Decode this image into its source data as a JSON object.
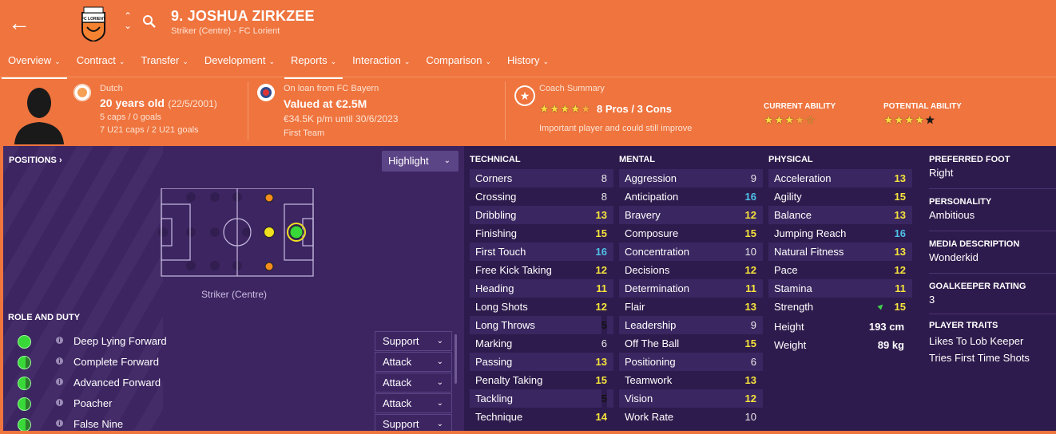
{
  "header": {
    "name": "9. JOSHUA ZIRKZEE",
    "subtitle": "Striker (Centre) - FC Lorient",
    "crest_text": "FC LORIENT"
  },
  "tabs": [
    {
      "label": "Overview",
      "active": true
    },
    {
      "label": "Contract"
    },
    {
      "label": "Transfer"
    },
    {
      "label": "Development"
    },
    {
      "label": "Reports",
      "active": true
    },
    {
      "label": "Interaction"
    },
    {
      "label": "Comparison"
    },
    {
      "label": "History"
    }
  ],
  "info": {
    "nationality": "Dutch",
    "age": "20 years old",
    "dob": "(22/5/2001)",
    "caps": "5 caps / 0 goals",
    "u21_caps": "7 U21 caps / 2 U21 goals",
    "loan_label": "On loan from FC Bayern",
    "value": "Valued at €2.5M",
    "wage": "€34.5K p/m until 30/6/2023",
    "squad": "First Team",
    "coach_label": "Coach Summary",
    "coach_rating": 4.5,
    "pros_cons": "8 Pros / 3 Cons",
    "coach_note": "Important player and could still improve",
    "ca_label": "CURRENT ABILITY",
    "ca_stars": 3.5,
    "pa_label": "POTENTIAL ABILITY",
    "pa_stars": 5
  },
  "positions": {
    "title": "POSITIONS",
    "highlight_label": "Highlight",
    "caption": "Striker (Centre)"
  },
  "roles": {
    "title": "ROLE AND DUTY",
    "items": [
      {
        "name": "Deep Lying Forward",
        "duty": "Support"
      },
      {
        "name": "Complete Forward",
        "duty": "Attack"
      },
      {
        "name": "Advanced Forward",
        "duty": "Attack"
      },
      {
        "name": "Poacher",
        "duty": "Attack"
      },
      {
        "name": "False Nine",
        "duty": "Support"
      }
    ]
  },
  "technical": {
    "title": "TECHNICAL",
    "rows": [
      {
        "name": "Corners",
        "value": "8"
      },
      {
        "name": "Crossing",
        "value": "8"
      },
      {
        "name": "Dribbling",
        "value": "13"
      },
      {
        "name": "Finishing",
        "value": "15"
      },
      {
        "name": "First Touch",
        "value": "16"
      },
      {
        "name": "Free Kick Taking",
        "value": "12"
      },
      {
        "name": "Heading",
        "value": "11"
      },
      {
        "name": "Long Shots",
        "value": "12"
      },
      {
        "name": "Long Throws",
        "value": "5"
      },
      {
        "name": "Marking",
        "value": "6"
      },
      {
        "name": "Passing",
        "value": "13"
      },
      {
        "name": "Penalty Taking",
        "value": "15"
      },
      {
        "name": "Tackling",
        "value": "5"
      },
      {
        "name": "Technique",
        "value": "14"
      }
    ]
  },
  "mental": {
    "title": "MENTAL",
    "rows": [
      {
        "name": "Aggression",
        "value": "9"
      },
      {
        "name": "Anticipation",
        "value": "16"
      },
      {
        "name": "Bravery",
        "value": "12"
      },
      {
        "name": "Composure",
        "value": "15"
      },
      {
        "name": "Concentration",
        "value": "10"
      },
      {
        "name": "Decisions",
        "value": "12"
      },
      {
        "name": "Determination",
        "value": "11"
      },
      {
        "name": "Flair",
        "value": "13"
      },
      {
        "name": "Leadership",
        "value": "9"
      },
      {
        "name": "Off The Ball",
        "value": "15"
      },
      {
        "name": "Positioning",
        "value": "6"
      },
      {
        "name": "Teamwork",
        "value": "13"
      },
      {
        "name": "Vision",
        "value": "12"
      },
      {
        "name": "Work Rate",
        "value": "10"
      }
    ]
  },
  "physical": {
    "title": "PHYSICAL",
    "rows": [
      {
        "name": "Acceleration",
        "value": "13"
      },
      {
        "name": "Agility",
        "value": "15"
      },
      {
        "name": "Balance",
        "value": "13"
      },
      {
        "name": "Jumping Reach",
        "value": "16"
      },
      {
        "name": "Natural Fitness",
        "value": "13"
      },
      {
        "name": "Pace",
        "value": "12"
      },
      {
        "name": "Stamina",
        "value": "11"
      },
      {
        "name": "Strength",
        "value": "15"
      }
    ],
    "height_label": "Height",
    "height": "193 cm",
    "weight_label": "Weight",
    "weight": "89 kg"
  },
  "details": {
    "foot_title": "PREFERRED FOOT",
    "foot": "Right",
    "personality_title": "PERSONALITY",
    "personality": "Ambitious",
    "media_title": "MEDIA DESCRIPTION",
    "media": "Wonderkid",
    "gk_title": "GOALKEEPER RATING",
    "gk": "3",
    "traits_title": "PLAYER TRAITS",
    "traits": [
      "Likes To Lob Keeper",
      "Tries First Time Shots"
    ]
  },
  "colors": {
    "header_bg": "#ef743e",
    "panel_left": "#3d2562",
    "panel_right": "#2e1b4d",
    "value_yellow": "#f6e33c",
    "value_cyan": "#4fc0e8",
    "role_green": "#39d839"
  }
}
